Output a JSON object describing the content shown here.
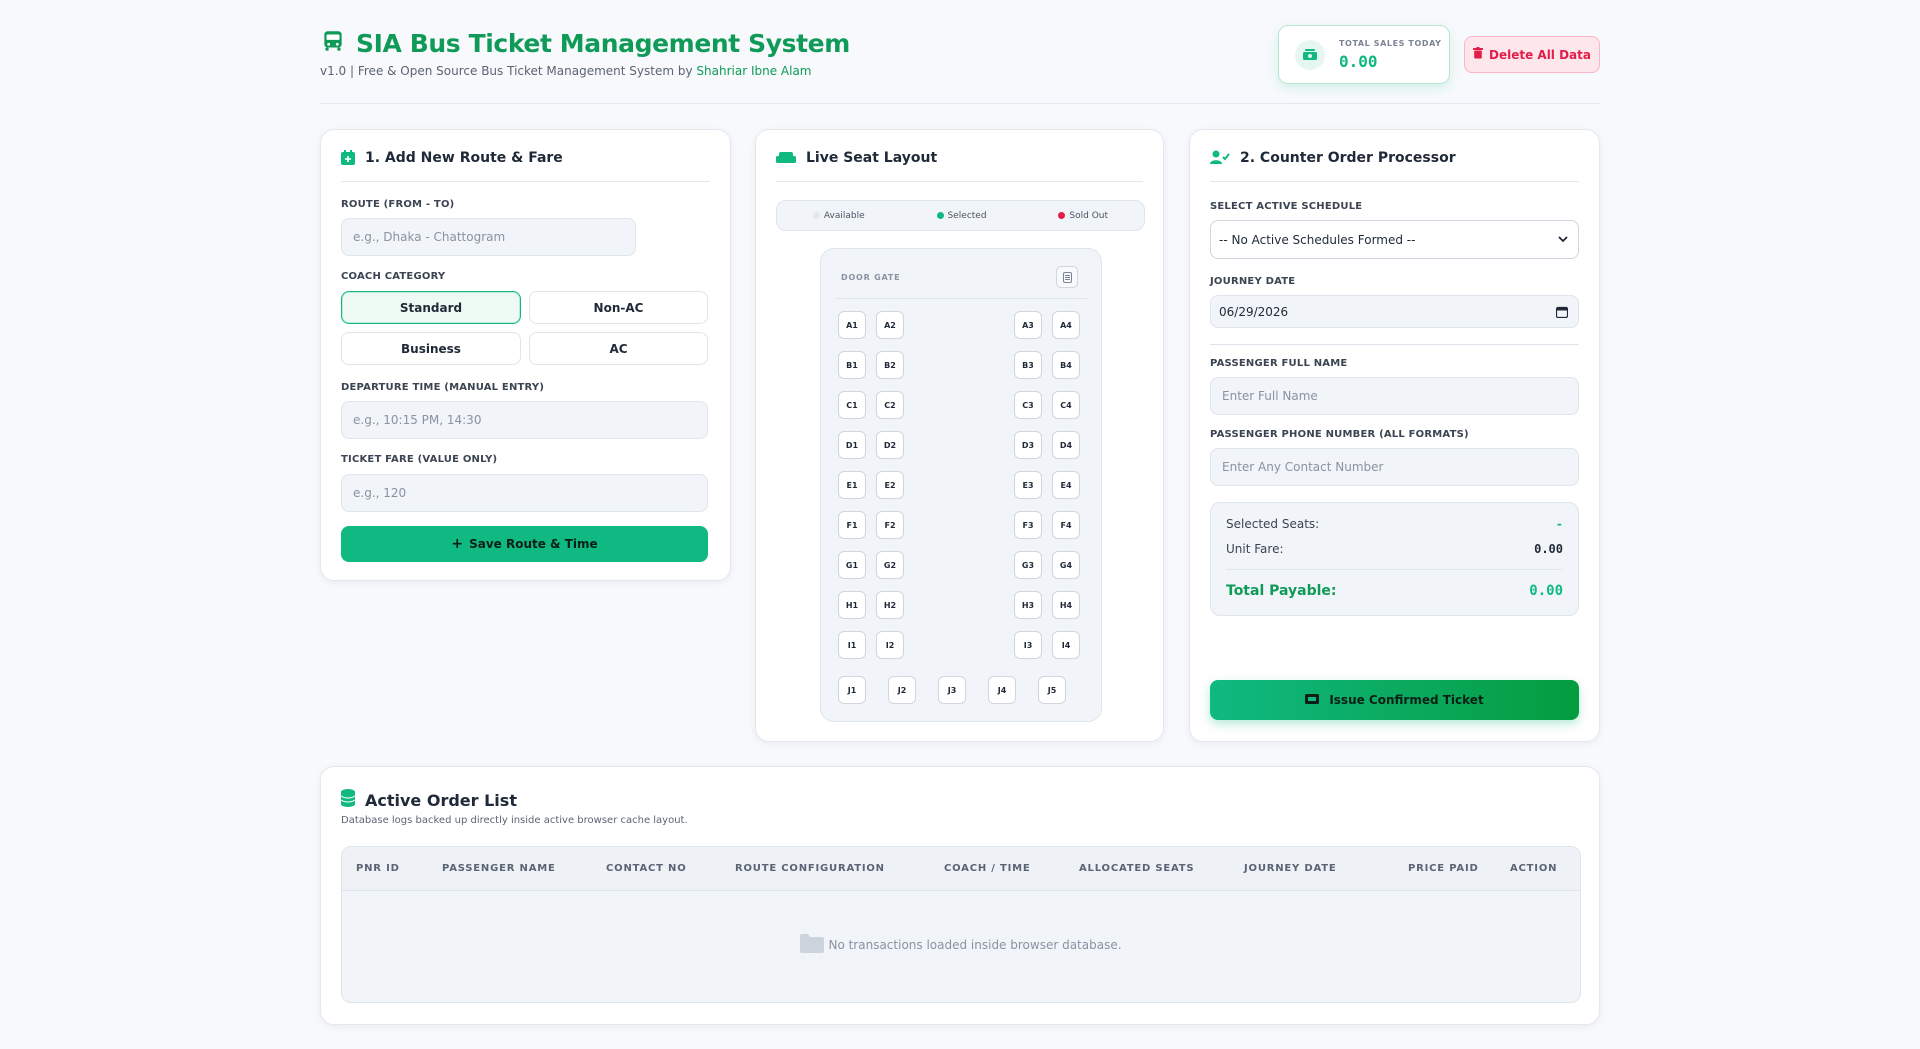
{
  "header": {
    "title": "SIA Bus Ticket Management System",
    "subtitle_prefix": "v1.0 | Free & Open Source Bus Ticket Management System by ",
    "author": "Shahriar Ibne Alam",
    "sales_label": "TOTAL SALES TODAY",
    "sales_value": "0.00",
    "delete_label": "Delete All Data"
  },
  "route_form": {
    "title": "1. Add New Route & Fare",
    "route_label": "ROUTE (FROM - TO)",
    "route_placeholder": "e.g., Dhaka - Chattogram",
    "category_label": "COACH CATEGORY",
    "categories": [
      "Standard",
      "Non-AC",
      "Business",
      "AC"
    ],
    "selected_category": "Standard",
    "departure_label": "DEPARTURE TIME (MANUAL ENTRY)",
    "departure_placeholder": "e.g., 10:15 PM, 14:30",
    "fare_label": "TICKET FARE (VALUE ONLY)",
    "fare_placeholder": "e.g., 120",
    "save_label": "Save Route & Time"
  },
  "seat_layout": {
    "title": "Live Seat Layout",
    "legend": {
      "available": "Available",
      "selected": "Selected",
      "sold_out": "Sold Out"
    },
    "door_label": "DOOR GATE",
    "rows": [
      [
        "A1",
        "A2",
        "A3",
        "A4"
      ],
      [
        "B1",
        "B2",
        "B3",
        "B4"
      ],
      [
        "C1",
        "C2",
        "C3",
        "C4"
      ],
      [
        "D1",
        "D2",
        "D3",
        "D4"
      ],
      [
        "E1",
        "E2",
        "E3",
        "E4"
      ],
      [
        "F1",
        "F2",
        "F3",
        "F4"
      ],
      [
        "G1",
        "G2",
        "G3",
        "G4"
      ],
      [
        "H1",
        "H2",
        "H3",
        "H4"
      ],
      [
        "I1",
        "I2",
        "I3",
        "I4"
      ]
    ],
    "back_row": [
      "J1",
      "J2",
      "J3",
      "J4",
      "J5"
    ]
  },
  "processor": {
    "title": "2. Counter Order Processor",
    "schedule_label": "SELECT ACTIVE SCHEDULE",
    "schedule_value": "-- No Active Schedules Formed --",
    "date_label": "JOURNEY DATE",
    "date_value": "06/29/2026",
    "name_label": "PASSENGER FULL NAME",
    "name_placeholder": "Enter Full Name",
    "phone_label": "PASSENGER PHONE NUMBER (ALL FORMATS)",
    "phone_placeholder": "Enter Any Contact Number",
    "selected_seats_label": "Selected Seats:",
    "selected_seats_value": "-",
    "unit_fare_label": "Unit Fare:",
    "unit_fare_value": "0.00",
    "total_label": "Total Payable:",
    "total_value": "0.00",
    "issue_label": "Issue Confirmed Ticket"
  },
  "orders": {
    "title": "Active Order List",
    "subtitle": "Database logs backed up directly inside active browser cache layout.",
    "columns": [
      "PNR ID",
      "PASSENGER NAME",
      "CONTACT NO",
      "ROUTE CONFIGURATION",
      "COACH / TIME",
      "ALLOCATED SEATS",
      "JOURNEY DATE",
      "PRICE PAID",
      "ACTION"
    ],
    "empty_text": "No transactions loaded inside browser database."
  },
  "colors": {
    "brand": "#0f9b57",
    "accent": "#10b981",
    "danger": "#e11d48",
    "available": "#e5e7eb",
    "selected": "#10b981",
    "sold_out": "#e11d48"
  }
}
